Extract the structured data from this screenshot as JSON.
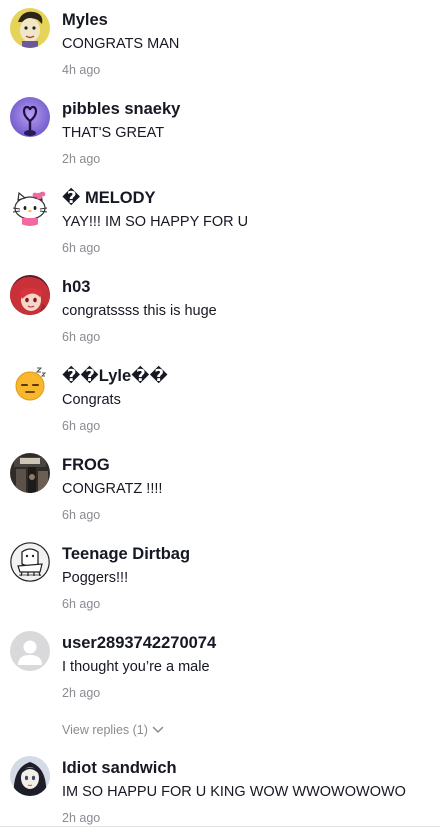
{
  "comments": [
    {
      "username": "Myles",
      "text": "CONGRATS MAN",
      "time": "4h ago",
      "avatar": "yellow-face-avatar-icon"
    },
    {
      "username": "pibbles snaeky",
      "text": "THAT'S GREAT",
      "time": "2h ago",
      "avatar": "purple-heart-avatar-icon"
    },
    {
      "username": "� MELODY",
      "text": "YAY!!! IM SO HAPPY FOR U",
      "time": "6h ago",
      "avatar": "hello-kitty-avatar-icon"
    },
    {
      "username": "h03",
      "text": "congratssss this is huge",
      "time": "6h ago",
      "avatar": "red-hair-anime-avatar-icon"
    },
    {
      "username": "��Lyle��",
      "text": "Congrats",
      "time": "6h ago",
      "avatar": "sleepy-emoji-avatar-icon"
    },
    {
      "username": "FROG",
      "text": "CONGRATZ !!!!",
      "time": "6h ago",
      "avatar": "dark-photo-avatar-icon"
    },
    {
      "username": "Teenage Dirtbag",
      "text": "Poggers!!!",
      "time": "6h ago",
      "avatar": "cartoon-drawing-avatar-icon"
    },
    {
      "username": "user2893742270074",
      "text": "I thought you’re a male",
      "time": "2h ago",
      "avatar": "default-user-avatar-icon"
    },
    {
      "username": "Idiot sandwich",
      "text": "IM SO HAPPU FOR U KING WOW WWOWOWOWO",
      "time": "2h ago",
      "avatar": "anime-girl-avatar-icon"
    }
  ],
  "replies": {
    "label": "View replies (1)",
    "icon": "chevron-down-icon"
  },
  "colors": {
    "text_primary": "#161823",
    "text_secondary": "#8a8b91",
    "divider": "#e3e3e4"
  }
}
